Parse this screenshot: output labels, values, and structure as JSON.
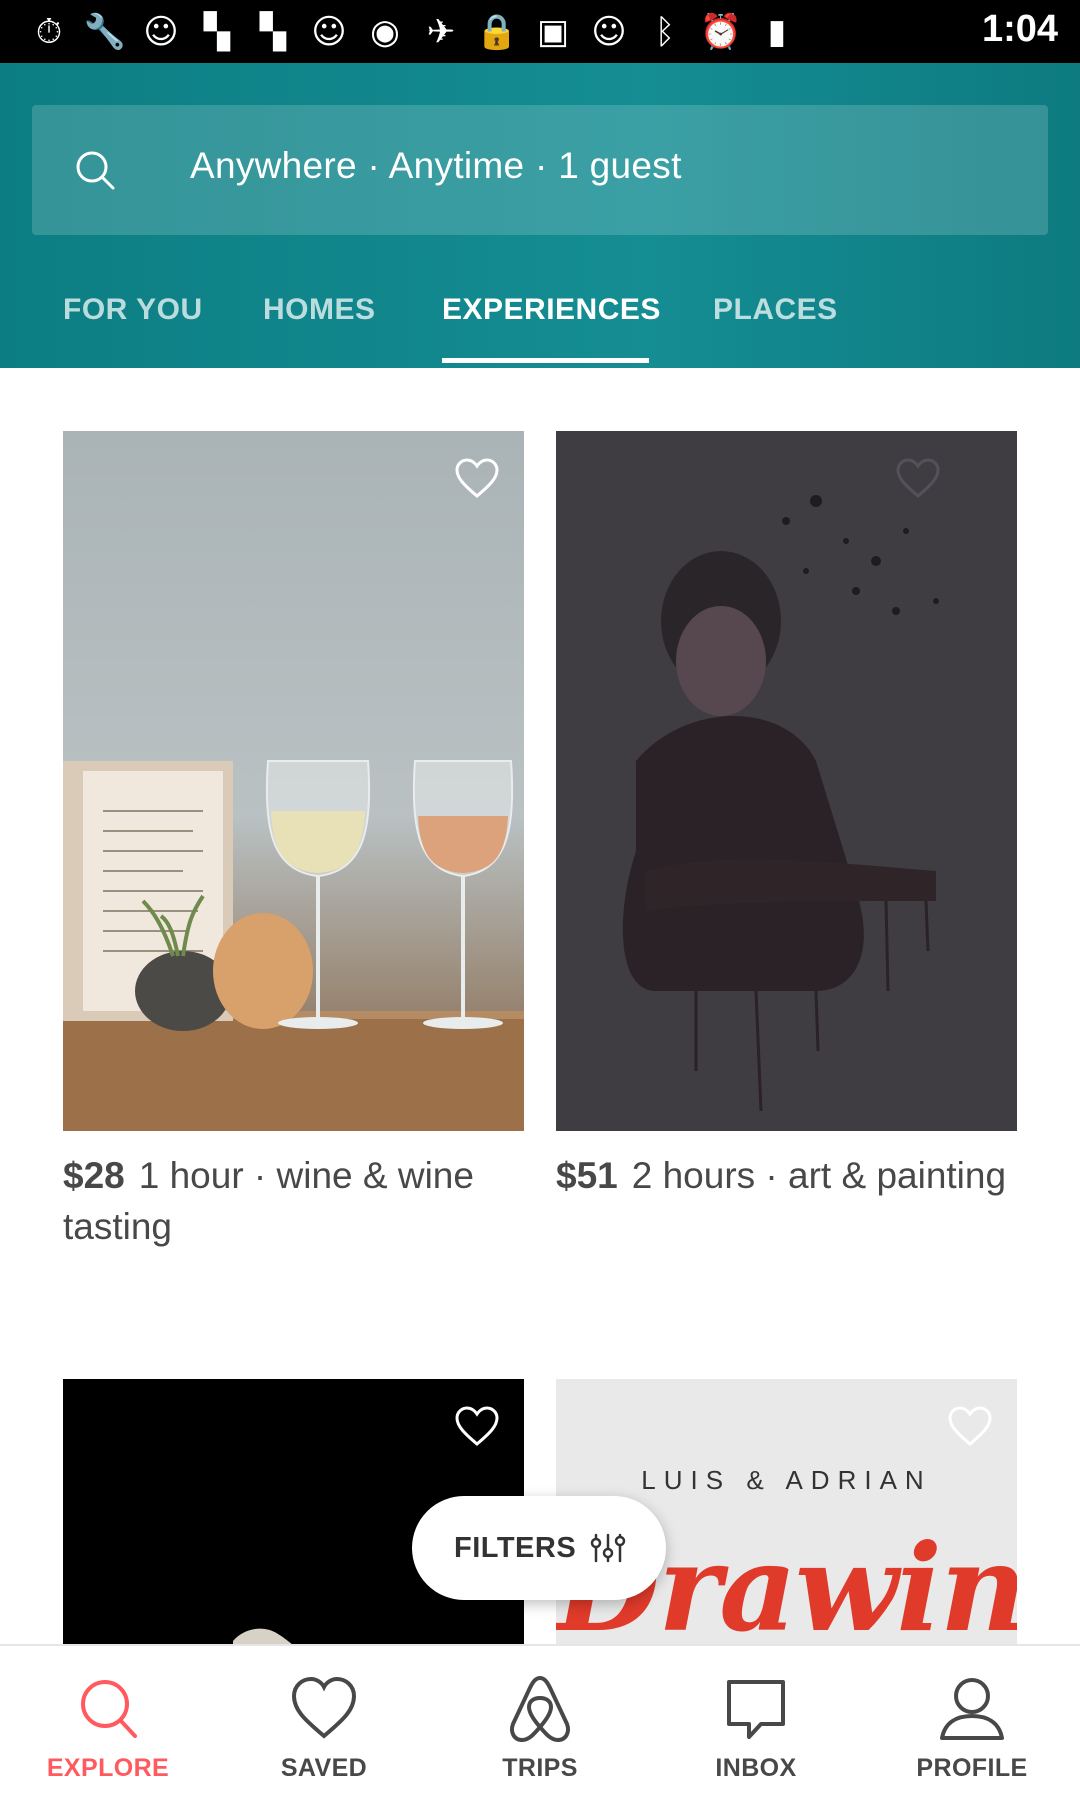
{
  "status_bar": {
    "time": "1:04",
    "icons": [
      "stopwatch-icon",
      "wrench-icon",
      "smiley-icon",
      "flipboard-icon",
      "flipboard-icon",
      "smiley-icon",
      "circle-icon",
      "fake-gps-icon",
      "lock-icon",
      "android-icon",
      "smiley-icon",
      "bluetooth-icon",
      "alarm-icon",
      "battery-charging-icon"
    ]
  },
  "search": {
    "text": "Anywhere · Anytime · 1 guest"
  },
  "tabs": [
    {
      "label": "FOR YOU",
      "active": false
    },
    {
      "label": "HOMES",
      "active": false
    },
    {
      "label": "EXPERIENCES",
      "active": true
    },
    {
      "label": "PLACES",
      "active": false
    }
  ],
  "cards": [
    {
      "price": "$28",
      "desc": "1 hour · wine & wine tasting",
      "image": "wine-glasses"
    },
    {
      "price": "$51",
      "desc": "2 hours · art & painting",
      "image": "painted-portrait"
    },
    {
      "image": "dark-photo"
    },
    {
      "image": "drawing-poster",
      "poster_text": "LUIS & ADRIAN",
      "poster_title": "Drawing"
    }
  ],
  "filters": {
    "label": "FILTERS"
  },
  "bottom_nav": [
    {
      "label": "EXPLORE",
      "icon": "search-icon",
      "active": true
    },
    {
      "label": "SAVED",
      "icon": "heart-icon",
      "active": false
    },
    {
      "label": "TRIPS",
      "icon": "airbnb-logo-icon",
      "active": false
    },
    {
      "label": "INBOX",
      "icon": "chat-bubble-icon",
      "active": false
    },
    {
      "label": "PROFILE",
      "icon": "person-icon",
      "active": false
    }
  ],
  "colors": {
    "header": "#148d93",
    "accent": "#ff5a5f",
    "text": "#484848"
  }
}
